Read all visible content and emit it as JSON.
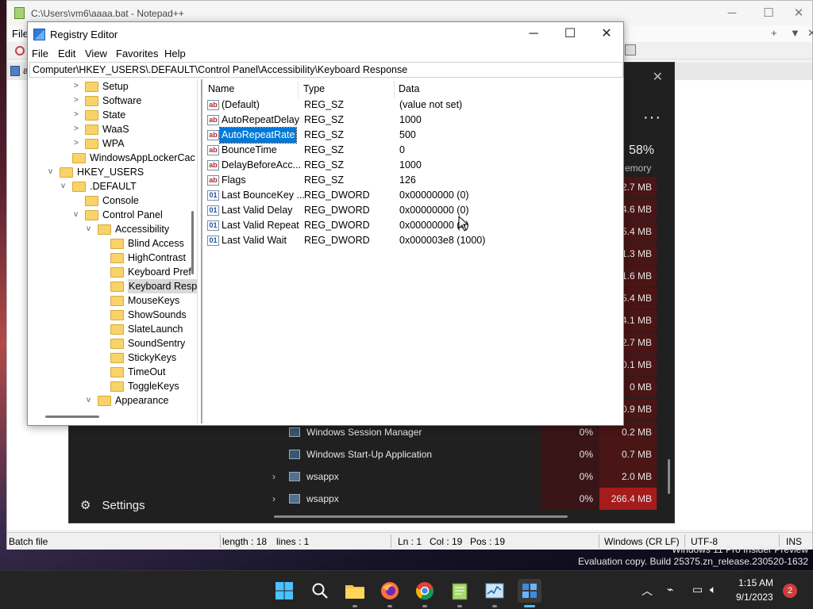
{
  "notepad": {
    "title": "C:\\Users\\vm6\\aaaa.bat - Notepad++",
    "menu_first": "File",
    "menu_right_icons": [
      "+",
      "▼",
      "✕"
    ],
    "tab_label": "a",
    "status": {
      "file_type": "Batch file",
      "length": "length : 18",
      "lines": "lines : 1",
      "ln": "Ln : 1",
      "col": "Col : 19",
      "pos": "Pos : 19",
      "eol": "Windows (CR LF)",
      "encoding": "UTF-8",
      "mode": "INS"
    }
  },
  "task_manager": {
    "memory_percent": "58%",
    "memory_label": "emory",
    "more_icon": "···",
    "settings_label": "Settings",
    "memory_column": [
      "2.7 MB",
      "4.6 MB",
      "5.4 MB",
      "1.3 MB",
      "1.6 MB",
      "5.4 MB",
      "4.1 MB",
      "2.7 MB",
      "0.1 MB",
      "0 MB",
      "0.9 MB"
    ],
    "rows": [
      {
        "expand": "",
        "name": "Windows Session Manager",
        "cpu": "0%",
        "mem": "0.2 MB"
      },
      {
        "expand": "",
        "name": "Windows Start-Up Application",
        "cpu": "0%",
        "mem": "0.7 MB"
      },
      {
        "expand": "›",
        "name": "wsappx",
        "cpu": "0%",
        "mem": "2.0 MB"
      },
      {
        "expand": "›",
        "name": "wsappx",
        "cpu": "0%",
        "mem": "266.4 MB"
      }
    ]
  },
  "registry": {
    "title": "Registry Editor",
    "menu": [
      "File",
      "Edit",
      "View",
      "Favorites",
      "Help"
    ],
    "address": "Computer\\HKEY_USERS\\.DEFAULT\\Control Panel\\Accessibility\\Keyboard Response",
    "tree": [
      {
        "label": "Setup",
        "arrow": ">"
      },
      {
        "label": "Software",
        "arrow": ">"
      },
      {
        "label": "State",
        "arrow": ">"
      },
      {
        "label": "WaaS",
        "arrow": ">"
      },
      {
        "label": "WPA",
        "arrow": ">"
      },
      {
        "label": "WindowsAppLockerCac",
        "arrow": ""
      },
      {
        "label": "HKEY_USERS",
        "arrow": "v"
      },
      {
        "label": ".DEFAULT",
        "arrow": "v"
      },
      {
        "label": "Console",
        "arrow": ""
      },
      {
        "label": "Control Panel",
        "arrow": "v"
      },
      {
        "label": "Accessibility",
        "arrow": "v"
      },
      {
        "label": "Blind Access",
        "arrow": ""
      },
      {
        "label": "HighContrast",
        "arrow": ""
      },
      {
        "label": "Keyboard Pref",
        "arrow": ""
      },
      {
        "label": "Keyboard Resp",
        "arrow": ""
      },
      {
        "label": "MouseKeys",
        "arrow": ""
      },
      {
        "label": "ShowSounds",
        "arrow": ""
      },
      {
        "label": "SlateLaunch",
        "arrow": ""
      },
      {
        "label": "SoundSentry",
        "arrow": ""
      },
      {
        "label": "StickyKeys",
        "arrow": ""
      },
      {
        "label": "TimeOut",
        "arrow": ""
      },
      {
        "label": "ToggleKeys",
        "arrow": ""
      },
      {
        "label": "Appearance",
        "arrow": "v"
      }
    ],
    "columns": {
      "name": "Name",
      "type": "Type",
      "data": "Data"
    },
    "values": [
      {
        "icon": "ab",
        "name": "(Default)",
        "type": "REG_SZ",
        "data": "(value not set)"
      },
      {
        "icon": "ab",
        "name": "AutoRepeatDelay",
        "type": "REG_SZ",
        "data": "1000"
      },
      {
        "icon": "ab",
        "name": "AutoRepeatRate",
        "type": "REG_SZ",
        "data": "500"
      },
      {
        "icon": "ab",
        "name": "BounceTime",
        "type": "REG_SZ",
        "data": "0"
      },
      {
        "icon": "ab",
        "name": "DelayBeforeAcc...",
        "type": "REG_SZ",
        "data": "1000"
      },
      {
        "icon": "ab",
        "name": "Flags",
        "type": "REG_SZ",
        "data": "126"
      },
      {
        "icon": "01",
        "name": "Last BounceKey ...",
        "type": "REG_DWORD",
        "data": "0x00000000 (0)"
      },
      {
        "icon": "01",
        "name": "Last Valid Delay",
        "type": "REG_DWORD",
        "data": "0x00000000 (0)"
      },
      {
        "icon": "01",
        "name": "Last Valid Repeat",
        "type": "REG_DWORD",
        "data": "0x00000000 (0)"
      },
      {
        "icon": "01",
        "name": "Last Valid Wait",
        "type": "REG_DWORD",
        "data": "0x000003e8 (1000)"
      }
    ]
  },
  "watermark": {
    "line1": "Windows 11 Pro Insider Preview",
    "line2": "Evaluation copy. Build 25375.zn_release.230520-1632"
  },
  "taskbar": {
    "time": "1:15 AM",
    "date": "9/1/2023",
    "notifications": "2"
  }
}
